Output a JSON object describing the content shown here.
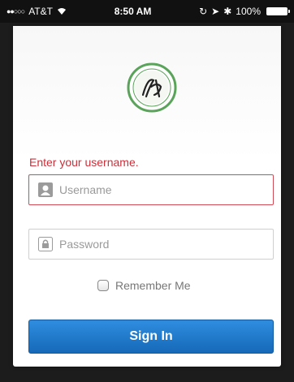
{
  "status_bar": {
    "carrier": "AT&T",
    "time": "8:50 AM",
    "battery": "100%"
  },
  "login": {
    "error_message": "Enter your username.",
    "username_placeholder": "Username",
    "username_value": "",
    "password_placeholder": "Password",
    "password_value": "",
    "remember_label": "Remember Me",
    "remember_checked": false,
    "sign_in_label": "Sign In"
  },
  "colors": {
    "error": "#c9303a",
    "primary_button": "#1f78cc",
    "logo_green": "#5aa35a"
  },
  "icons": {
    "username": "user-icon",
    "password": "lock-icon"
  }
}
